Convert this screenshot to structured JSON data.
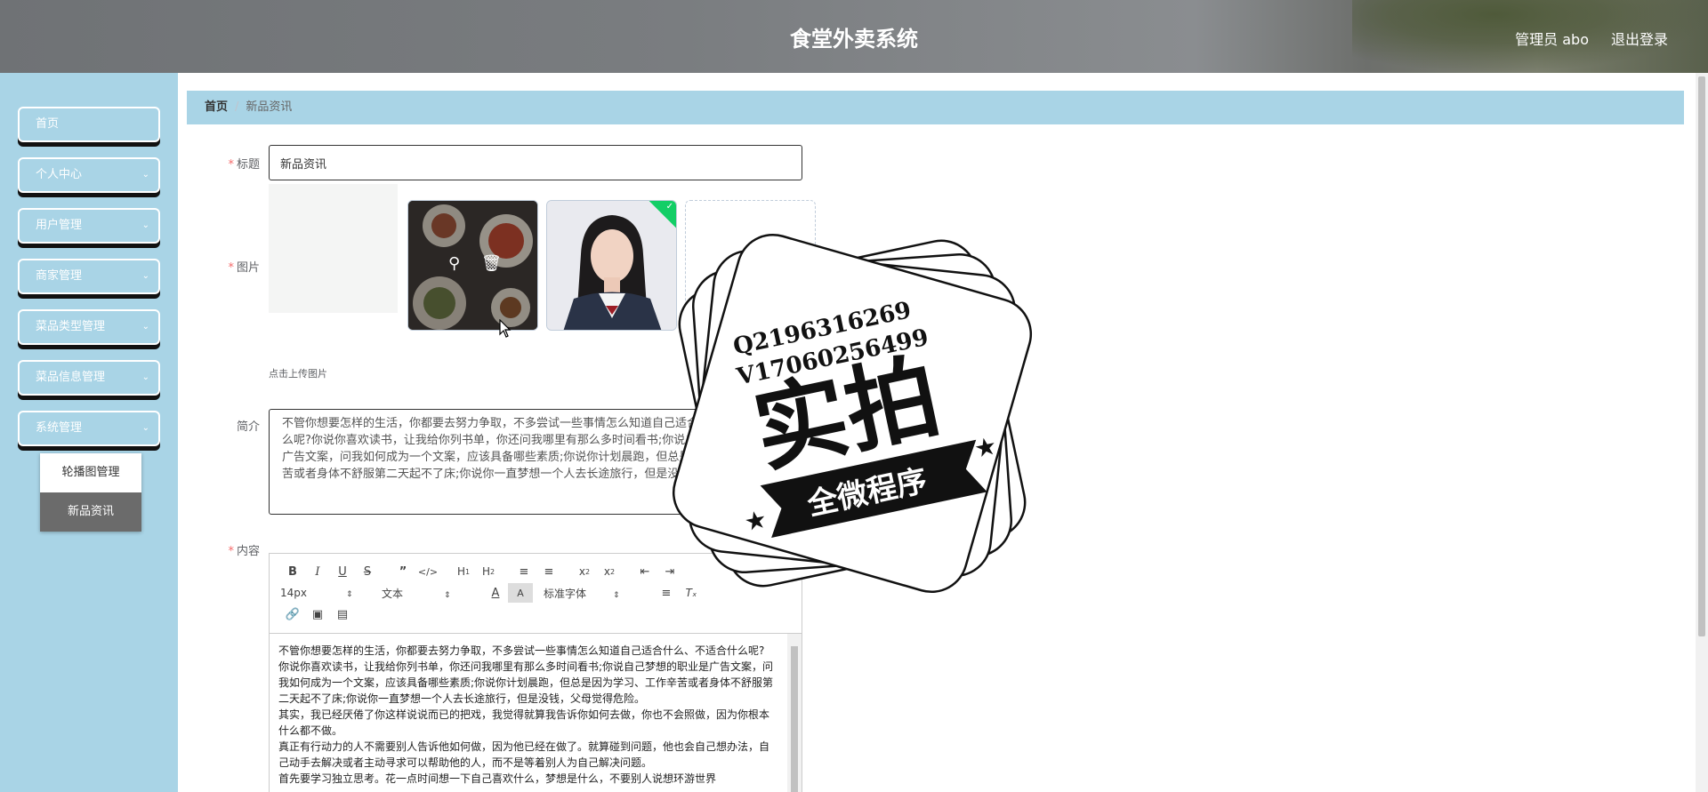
{
  "header": {
    "title": "食堂外卖系统",
    "admin": "管理员 abo",
    "logout": "退出登录"
  },
  "sidebar": {
    "items": [
      {
        "label": "首页",
        "has_arrow": false
      },
      {
        "label": "个人中心",
        "has_arrow": true
      },
      {
        "label": "用户管理",
        "has_arrow": true
      },
      {
        "label": "商家管理",
        "has_arrow": true
      },
      {
        "label": "菜品类型管理",
        "has_arrow": true
      },
      {
        "label": "菜品信息管理",
        "has_arrow": true
      },
      {
        "label": "系统管理",
        "has_arrow": true
      }
    ],
    "submenu": [
      {
        "label": "轮播图管理",
        "active": false
      },
      {
        "label": "新品资讯",
        "active": true
      }
    ]
  },
  "breadcrumb": {
    "home": "首页",
    "current": "新品资讯"
  },
  "form": {
    "title_label": "标题",
    "title_value": "新品资讯",
    "image_label": "图片",
    "upload_tip": "点击上传图片",
    "intro_label": "简介",
    "intro_text": "不管你想要怎样的生活，你都要去努力争取，不多尝试一些事情怎么知道自己适合什么、不适合什么呢?你说你喜欢读书，让我给你列书单，你还问我哪里有那么多时间看书;你说自己梦想的职业是广告文案，问我如何成为一个文案，应该具备哪些素质;你说你计划晨跑，但总是因为学习、工作辛苦或者身体不舒服第二天起不了床;你说你一直梦想一个人去长途旅行，但是没钱，父母觉得危险。",
    "content_label": "内容"
  },
  "editor": {
    "font_size": "14px",
    "header_select": "文本",
    "font_family": "标准字体",
    "body": "不管你想要怎样的生活，你都要去努力争取，不多尝试一些事情怎么知道自己适合什么、不适合什么呢?\n你说你喜欢读书，让我给你列书单，你还问我哪里有那么多时间看书;你说自己梦想的职业是广告文案，问我如何成为一个文案，应该具备哪些素质;你说你计划晨跑，但总是因为学习、工作辛苦或者身体不舒服第二天起不了床;你说你一直梦想一个人去长途旅行，但是没钱，父母觉得危险。\n其实，我已经厌倦了你这样说说而已的把戏，我觉得就算我告诉你如何去做，你也不会照做，因为你根本什么都不做。\n真正有行动力的人不需要别人告诉他如何做，因为他已经在做了。就算碰到问题，他也会自己想办法，自己动手去解决或者主动寻求可以帮助他的人，而不是等着别人为自己解决问题。\n首先要学习独立思考。花一点时间想一下自己喜欢什么，梦想是什么，不要别人说想环游世界"
  },
  "stamp": {
    "line1": "Q2196316269",
    "line2": "V17060256499",
    "big": "实拍",
    "banner": "全微程序"
  },
  "colors": {
    "accent": "#a9d4e6",
    "required": "#f56c6c",
    "success": "#13ce66"
  }
}
